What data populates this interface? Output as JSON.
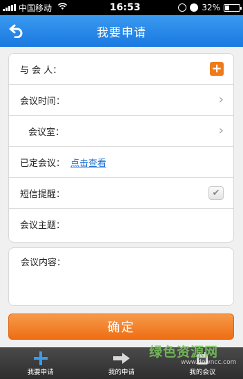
{
  "status_bar": {
    "carrier": "中国移动",
    "time": "16:53",
    "battery": "32%",
    "battery_level": 0.32
  },
  "header": {
    "title": "我要申请"
  },
  "form": {
    "participants_label": "与 会 人：",
    "meeting_time_label": "会议时间：",
    "meeting_room_label": "会议室：",
    "booked_meetings_label": "已定会议：",
    "booked_meetings_link": "点击查看",
    "sms_reminder_label": "短信提醒：",
    "sms_reminder_checked": true,
    "meeting_topic_label": "会议主题："
  },
  "content": {
    "label": "会议内容："
  },
  "confirm_label": "确定",
  "tabs": [
    {
      "label": "我要申请",
      "icon": "plus-icon"
    },
    {
      "label": "我的申请",
      "icon": "arrow-right-icon"
    },
    {
      "label": "我的会议",
      "icon": "calendar-icon"
    }
  ],
  "watermark": {
    "text": "绿色资源网",
    "url": "www.downcc.com"
  },
  "colors": {
    "header_blue": "#2a88e8",
    "accent_orange": "#f07a1a",
    "link_blue": "#1a6fd0"
  }
}
